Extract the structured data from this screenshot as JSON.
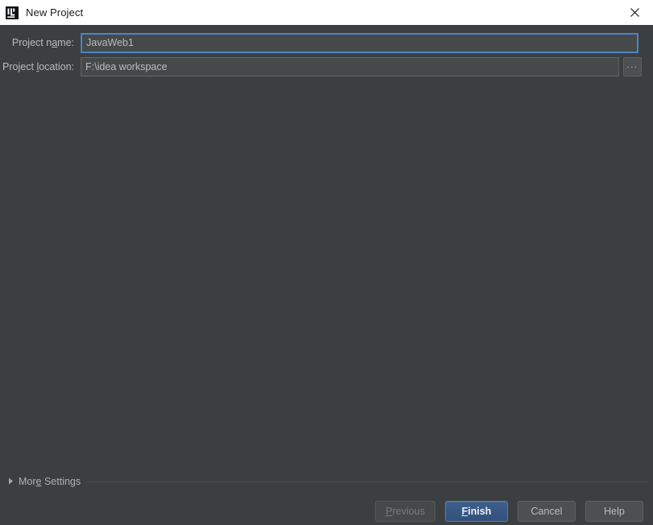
{
  "window": {
    "title": "New Project",
    "icon": "intellij-idea-icon",
    "close_icon": "close-icon",
    "background_color": "#3c3f41",
    "titlebar_color": "#ffffff"
  },
  "form": {
    "project_name": {
      "label_before": "Project n",
      "label_mnemonic": "a",
      "label_after": "me:",
      "value": "JavaWeb1",
      "placeholder": "",
      "focused": true,
      "focus_border_color": "#4b84c4"
    },
    "project_location": {
      "label_before": "Project ",
      "label_mnemonic": "l",
      "label_after": "ocation:",
      "value": "F:\\idea workspace",
      "placeholder": "",
      "focused": false,
      "browse_label": "...",
      "browse_icon": "ellipsis-icon"
    }
  },
  "more_settings": {
    "label_before": "Mor",
    "label_mnemonic": "e",
    "label_after": " Settings",
    "expanded": false,
    "triangle_icon": "chevron-right-icon"
  },
  "buttons": {
    "previous": {
      "label_before": "",
      "label_mnemonic": "P",
      "label_after": "revious",
      "enabled": false,
      "default": false
    },
    "finish": {
      "label_before": "",
      "label_mnemonic": "F",
      "label_after": "inish",
      "enabled": true,
      "default": true,
      "accent_color": "#365880"
    },
    "cancel": {
      "label": "Cancel",
      "enabled": true,
      "default": false
    },
    "help": {
      "label": "Help",
      "enabled": true,
      "default": false
    }
  }
}
